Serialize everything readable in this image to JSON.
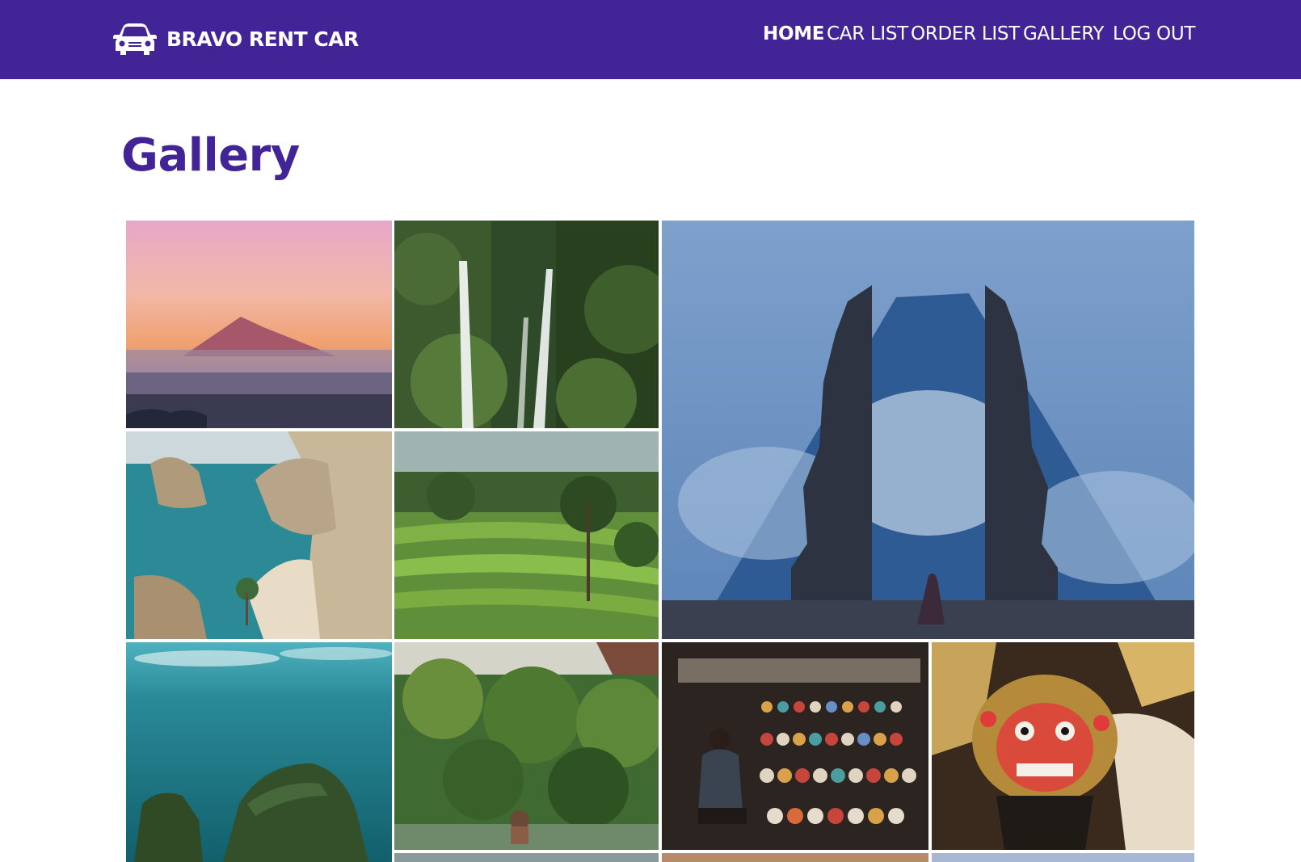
{
  "brand": {
    "name": "BRAVO RENT CAR",
    "icon": "car-icon"
  },
  "nav": {
    "items": [
      {
        "label": "HOME",
        "active": true
      },
      {
        "label": "CAR LIST",
        "active": false
      },
      {
        "label": "ORDER LIST",
        "active": false
      },
      {
        "label": "GALLERY",
        "active": false
      },
      {
        "label": "LOG OUT",
        "active": false
      }
    ]
  },
  "page": {
    "title": "Gallery"
  },
  "colors": {
    "primary": "#432496",
    "background": "#ffffff",
    "nav_text": "#ffffff"
  },
  "gallery": {
    "photos": [
      "mountain-sunset-photo",
      "waterfall-photo",
      "temple-gate-mountain-photo",
      "beach-cliffs-photo",
      "rice-terraces-photo",
      "ocean-rocks-photo",
      "jungle-pool-photo",
      "mask-market-photo",
      "barong-mask-photo"
    ]
  }
}
